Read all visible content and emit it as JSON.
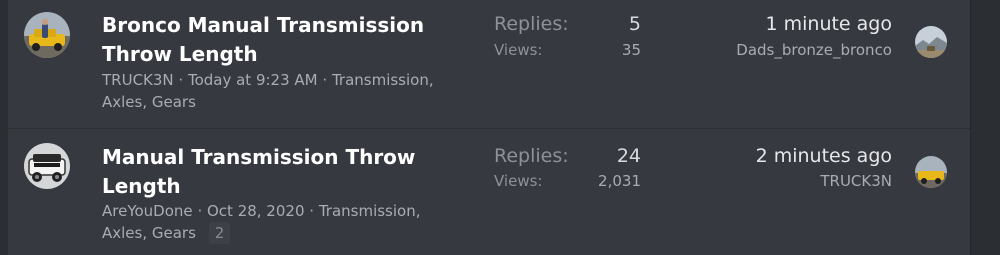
{
  "threads": [
    {
      "title": "Bronco Manual Transmission Throw Length",
      "title_line1": "Bronco Manual Transmission",
      "title_line2": "Throw Length",
      "starter": "TRUCK3N",
      "date": "Today at 9:23 AM",
      "forum_line1": "Transmission,",
      "forum_line2": "Axles, Gears",
      "replies_label": "Replies:",
      "replies": "5",
      "views_label": "Views:",
      "views": "35",
      "latest_time": "1 minute ago",
      "latest_user": "Dads_bronze_bronco",
      "avatar_icon": "user-avatar-yellow-bronco",
      "latest_avatar_icon": "user-avatar-landscape"
    },
    {
      "title": "Manual Transmission Throw Length",
      "title_line1": "Manual Transmission Throw",
      "title_line2": "Length",
      "starter": "AreYouDone",
      "date": "Oct 28, 2020",
      "forum_line1": "Transmission,",
      "forum_line2": "Axles, Gears",
      "page_badge": "2",
      "replies_label": "Replies:",
      "replies": "24",
      "views_label": "Views:",
      "views": "2,031",
      "latest_time": "2 minutes ago",
      "latest_user": "TRUCK3N",
      "avatar_icon": "user-avatar-white-bronco",
      "latest_avatar_icon": "user-avatar-yellow-bronco"
    }
  ],
  "colors": {
    "background": "#2b2e33",
    "row_bg": "#36393f",
    "title": "#ffffff",
    "meta": "#a9acb3"
  }
}
